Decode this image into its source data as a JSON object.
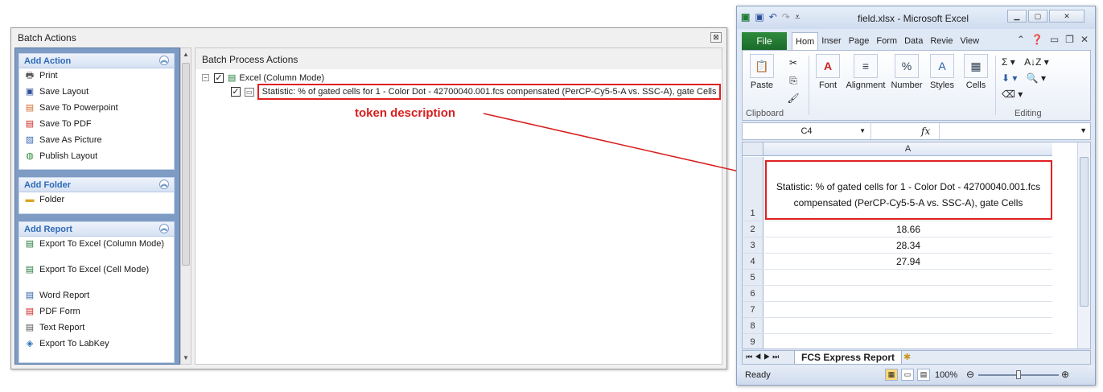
{
  "batch": {
    "title": "Batch Actions",
    "close": "⊠",
    "groups": [
      {
        "title": "Add Action",
        "items": [
          {
            "label": "Print",
            "icon": "printer-icon"
          },
          {
            "label": "Save Layout",
            "icon": "save-icon"
          },
          {
            "label": "Save To Powerpoint",
            "icon": "powerpoint-icon"
          },
          {
            "label": "Save To PDF",
            "icon": "pdf-icon"
          },
          {
            "label": "Save As Picture",
            "icon": "picture-icon"
          },
          {
            "label": "Publish Layout",
            "icon": "globe-icon"
          }
        ]
      },
      {
        "title": "Add Folder",
        "items": [
          {
            "label": "Folder",
            "icon": "folder-icon"
          }
        ]
      },
      {
        "title": "Add Report",
        "items": [
          {
            "label": "Export To Excel (Column Mode)",
            "icon": "excel-icon"
          },
          {
            "label": "Export To Excel (Cell Mode)",
            "icon": "excel-icon"
          },
          {
            "label": "Word Report",
            "icon": "word-icon"
          },
          {
            "label": "PDF Form",
            "icon": "pdf-form-icon"
          },
          {
            "label": "Text Report",
            "icon": "text-icon"
          },
          {
            "label": "Export To LabKey",
            "icon": "labkey-icon"
          }
        ]
      }
    ],
    "right_title": "Batch Process Actions",
    "tree": {
      "root": "Excel (Column Mode)",
      "child": "Statistic: % of gated cells for 1 - Color Dot - 42700040.001.fcs compensated (PerCP-Cy5-5-A vs. SSC-A), gate Cells"
    }
  },
  "annotation": {
    "label": "token description",
    "color": "#d81e1e"
  },
  "excel": {
    "title": "field.xlsx  -  Microsoft Excel",
    "tabs": [
      "File",
      "Hom",
      "Inser",
      "Page",
      "Form",
      "Data",
      "Revie",
      "View"
    ],
    "active_tab": "Hom",
    "ribbon": {
      "paste": "Paste",
      "clipboard": "Clipboard",
      "font": "Font",
      "alignment": "Alignment",
      "number": "Number",
      "styles": "Styles",
      "cells": "Cells",
      "editing": "Editing"
    },
    "name_box": "C4",
    "fx": "fx",
    "column": "A",
    "rows": [
      "1",
      "2",
      "3",
      "4",
      "5",
      "6",
      "7",
      "8",
      "9"
    ],
    "cells": [
      "Statistic: % of gated cells for 1 - Color Dot - 42700040.001.fcs compensated (PerCP-Cy5-5-A vs. SSC-A), gate Cells",
      "18.66",
      "28.34",
      "27.94",
      "",
      "",
      "",
      "",
      ""
    ],
    "sheet_tab": "FCS Express Report",
    "status": "Ready",
    "zoom": "100%"
  }
}
